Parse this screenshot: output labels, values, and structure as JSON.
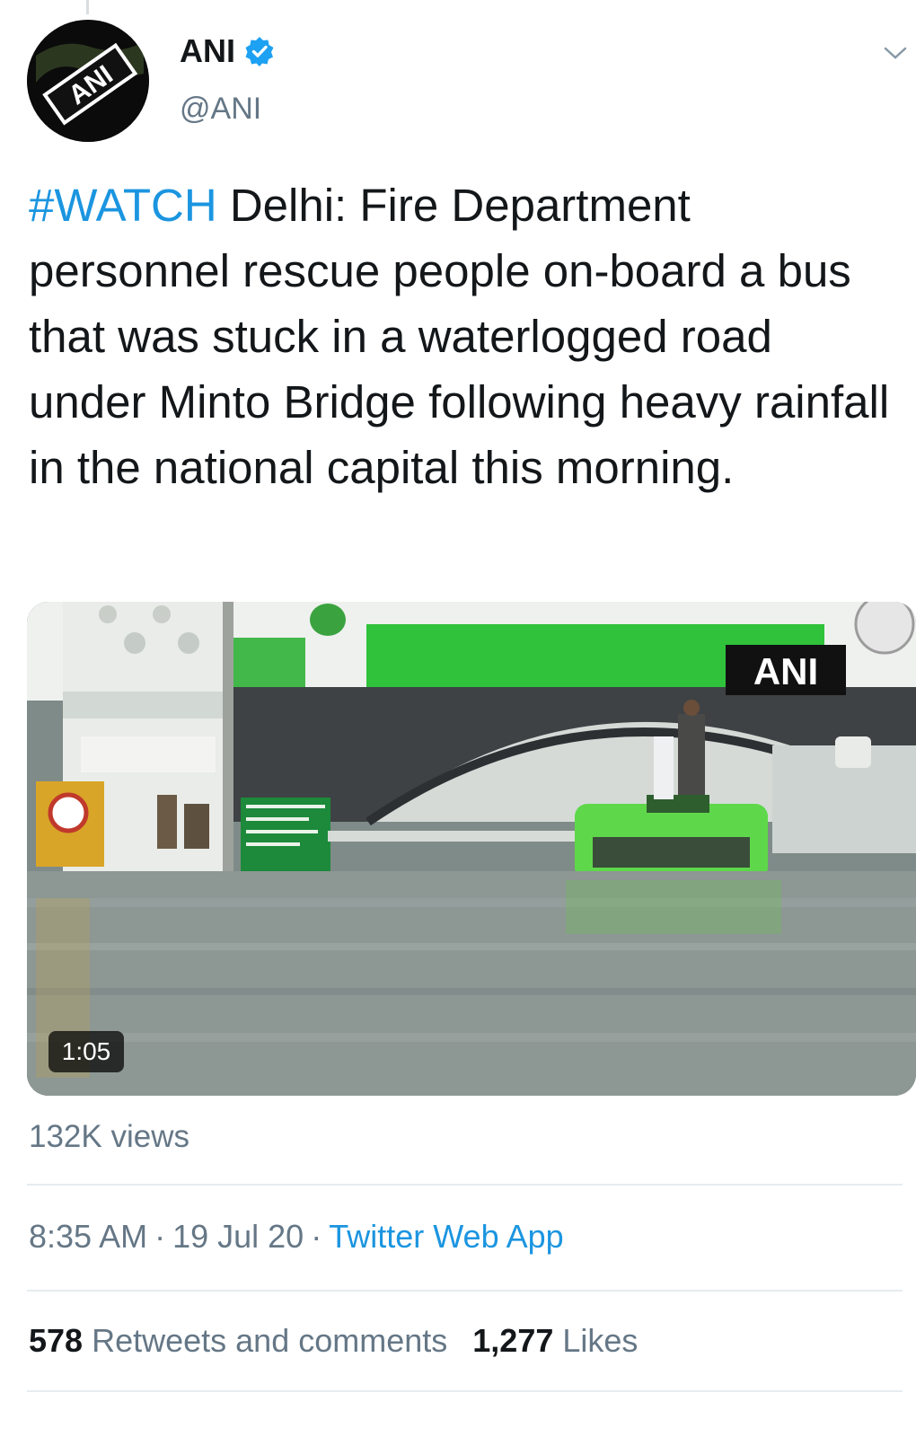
{
  "author": {
    "display_name": "ANI",
    "handle": "@ANI",
    "avatar_icon": "ani-logo-icon",
    "avatar_text": "ANI",
    "verified_icon": "verified-badge-icon"
  },
  "tweet": {
    "hashtag": "#WATCH",
    "text": " Delhi: Fire Department personnel rescue people on-board a bus that was stuck in a waterlogged road under Minto Bridge following heavy rainfall in the national capital this morning."
  },
  "media": {
    "watermark": "ANI",
    "duration": "1:05",
    "views": "132K views"
  },
  "meta": {
    "time": "8:35 AM",
    "separator": "·",
    "date": "19 Jul 20",
    "source": "Twitter Web App"
  },
  "stats": {
    "retweets_count": "578",
    "retweets_label": "Retweets and comments",
    "likes_count": "1,277",
    "likes_label": "Likes"
  },
  "colors": {
    "link_blue": "#1b95e0",
    "secondary_text": "#657786",
    "primary_text": "#14171a",
    "divider": "#e6ecf0"
  }
}
